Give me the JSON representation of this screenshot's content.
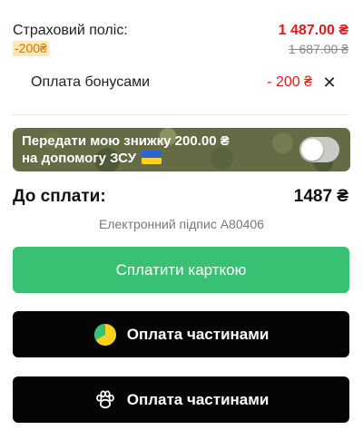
{
  "policy": {
    "label": "Страховий поліс:",
    "discount": "-200₴",
    "price_new": "1 487.00 ₴",
    "price_old": "1 687.00 ₴"
  },
  "bonus": {
    "label": "Оплата бонусами",
    "amount": "- 200 ₴",
    "remove_glyph": "✕"
  },
  "zsu_banner": {
    "line1": "Передати мою знижку 200.00 ₴",
    "line2": "на допомогу ЗСУ",
    "toggle_on": false,
    "flag_colors": [
      "#2b64d6",
      "#ffd21e"
    ]
  },
  "total": {
    "label": "До сплати:",
    "amount": "1487 ₴"
  },
  "signature": "Електронний підпис А80406",
  "buttons": {
    "card": "Сплатити карткою",
    "parts_1": "Оплата частинами",
    "parts_2": "Оплата частинами"
  },
  "icons": {
    "parts_1": "installment-pie-icon",
    "parts_2": "paw-icon"
  },
  "colors": {
    "accent_green": "#38c172",
    "price_red": "#e01b1b",
    "discount_orange": "#e07000"
  }
}
